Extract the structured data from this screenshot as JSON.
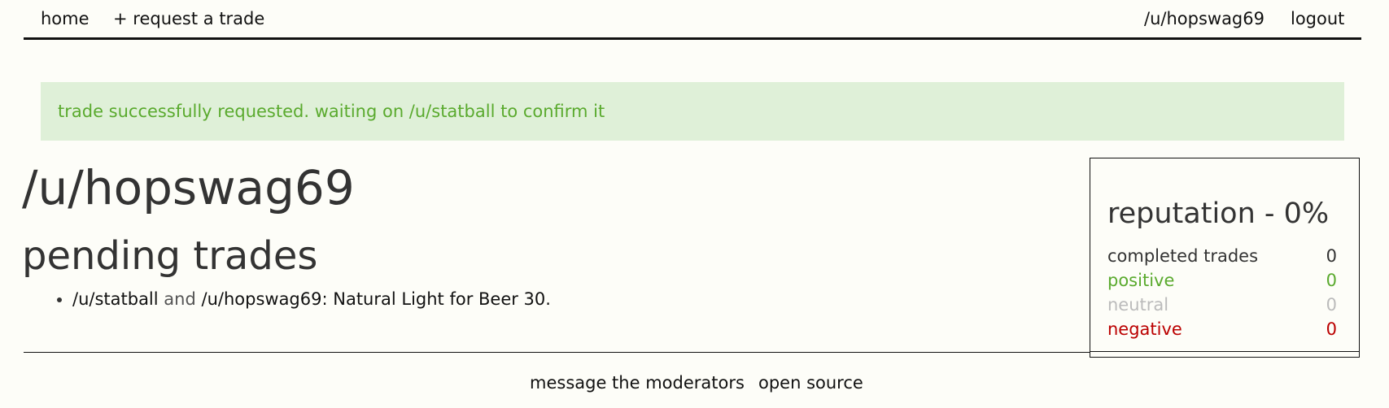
{
  "nav": {
    "home": "home",
    "request_trade": "+ request a trade",
    "user": "/u/hopswag69",
    "logout": "logout"
  },
  "alert": {
    "message": "trade successfully requested. waiting on /u/statball to confirm it"
  },
  "profile": {
    "username": "/u/hopswag69",
    "pending_heading": "pending trades",
    "pending_trades": [
      {
        "user_a": "/u/statball",
        "conjunction": "and",
        "user_b": "/u/hopswag69",
        "details": ": Natural Light for Beer 30."
      }
    ]
  },
  "reputation": {
    "title": "reputation - 0%",
    "completed_label": "completed trades",
    "completed_value": "0",
    "positive_label": "positive",
    "positive_value": "0",
    "neutral_label": "neutral",
    "neutral_value": "0",
    "negative_label": "negative",
    "negative_value": "0"
  },
  "footer": {
    "message_mods": "message the moderators",
    "open_source": "open source"
  },
  "colors": {
    "background": "#fdfdf8",
    "alert_bg": "#dff0d8",
    "success_green": "#5aaa2e",
    "neutral_gray": "#bbbbbb",
    "negative_red": "#bb0000"
  }
}
